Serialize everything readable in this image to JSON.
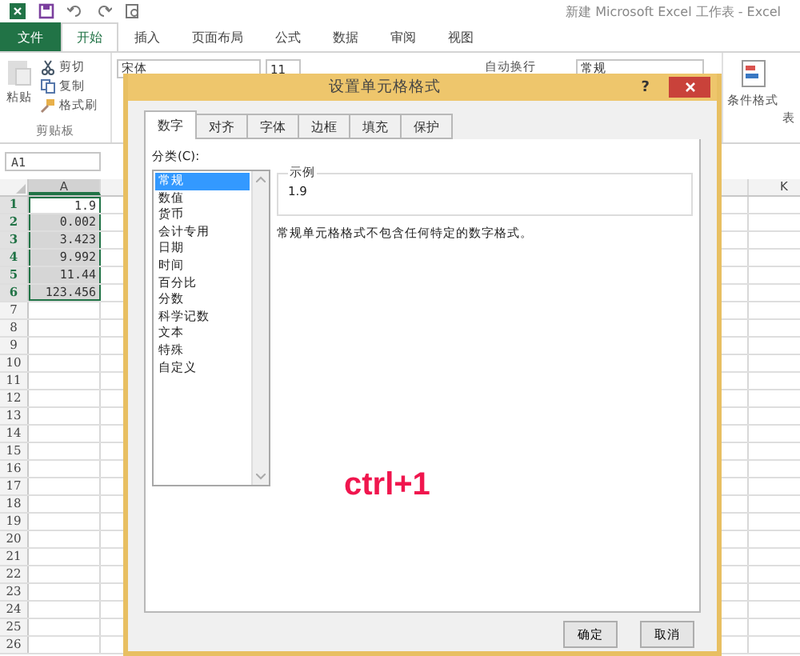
{
  "app": {
    "title": "新建 Microsoft Excel 工作表 - Excel"
  },
  "ribbon_tabs": [
    {
      "label": "文件",
      "kind": "file",
      "selected": false
    },
    {
      "label": "开始",
      "kind": "tab",
      "selected": true
    },
    {
      "label": "插入",
      "kind": "tab",
      "selected": false
    },
    {
      "label": "页面布局",
      "kind": "tab",
      "selected": false
    },
    {
      "label": "公式",
      "kind": "tab",
      "selected": false
    },
    {
      "label": "数据",
      "kind": "tab",
      "selected": false
    },
    {
      "label": "审阅",
      "kind": "tab",
      "selected": false
    },
    {
      "label": "视图",
      "kind": "tab",
      "selected": false
    }
  ],
  "clipboard": {
    "paste": "粘贴",
    "cut": "剪切",
    "copy": "复制",
    "format_painter": "格式刷",
    "group": "剪贴板"
  },
  "font": {
    "name": "宋体",
    "size": "11"
  },
  "wrap_text": "自动换行",
  "number_format": "常规",
  "conditional_format": "条件格式",
  "table_format": "表",
  "name_box": "A1",
  "sheet": {
    "column_a": "A",
    "column_k": "K",
    "rows": [
      {
        "number": "1",
        "value": "1.9",
        "selected": true
      },
      {
        "number": "2",
        "value": "0.002",
        "selected": true
      },
      {
        "number": "3",
        "value": "3.423",
        "selected": true
      },
      {
        "number": "4",
        "value": "9.992",
        "selected": true
      },
      {
        "number": "5",
        "value": "11.44",
        "selected": true
      },
      {
        "number": "6",
        "value": "123.456",
        "selected": true
      },
      {
        "number": "7",
        "selected": false
      },
      {
        "number": "8",
        "selected": false
      },
      {
        "number": "9",
        "selected": false
      },
      {
        "number": "10",
        "selected": false
      },
      {
        "number": "11",
        "selected": false
      },
      {
        "number": "12",
        "selected": false
      },
      {
        "number": "13",
        "selected": false
      },
      {
        "number": "14",
        "selected": false
      },
      {
        "number": "15",
        "selected": false
      },
      {
        "number": "16",
        "selected": false
      },
      {
        "number": "17",
        "selected": false
      },
      {
        "number": "18",
        "selected": false
      },
      {
        "number": "19",
        "selected": false
      },
      {
        "number": "20",
        "selected": false
      },
      {
        "number": "21",
        "selected": false
      },
      {
        "number": "22",
        "selected": false
      },
      {
        "number": "23",
        "selected": false
      },
      {
        "number": "24",
        "selected": false
      },
      {
        "number": "25",
        "selected": false
      },
      {
        "number": "26",
        "selected": false
      }
    ]
  },
  "dialog": {
    "title": "设置单元格格式",
    "help": "?",
    "tabs": [
      {
        "label": "数字",
        "selected": true
      },
      {
        "label": "对齐",
        "selected": false
      },
      {
        "label": "字体",
        "selected": false
      },
      {
        "label": "边框",
        "selected": false
      },
      {
        "label": "填充",
        "selected": false
      },
      {
        "label": "保护",
        "selected": false
      }
    ],
    "category_label": "分类(C):",
    "categories": [
      {
        "label": "常规",
        "selected": true
      },
      {
        "label": "数值",
        "selected": false
      },
      {
        "label": "货币",
        "selected": false
      },
      {
        "label": "会计专用",
        "selected": false
      },
      {
        "label": "日期",
        "selected": false
      },
      {
        "label": "时间",
        "selected": false
      },
      {
        "label": "百分比",
        "selected": false
      },
      {
        "label": "分数",
        "selected": false
      },
      {
        "label": "科学记数",
        "selected": false
      },
      {
        "label": "文本",
        "selected": false
      },
      {
        "label": "特殊",
        "selected": false
      },
      {
        "label": "自定义",
        "selected": false
      }
    ],
    "sample_label": "示例",
    "sample_value": "1.9",
    "description": "常规单元格格式不包含任何特定的数字格式。",
    "buttons": [
      "确定",
      "取消"
    ]
  },
  "annotation": "ctrl+1"
}
